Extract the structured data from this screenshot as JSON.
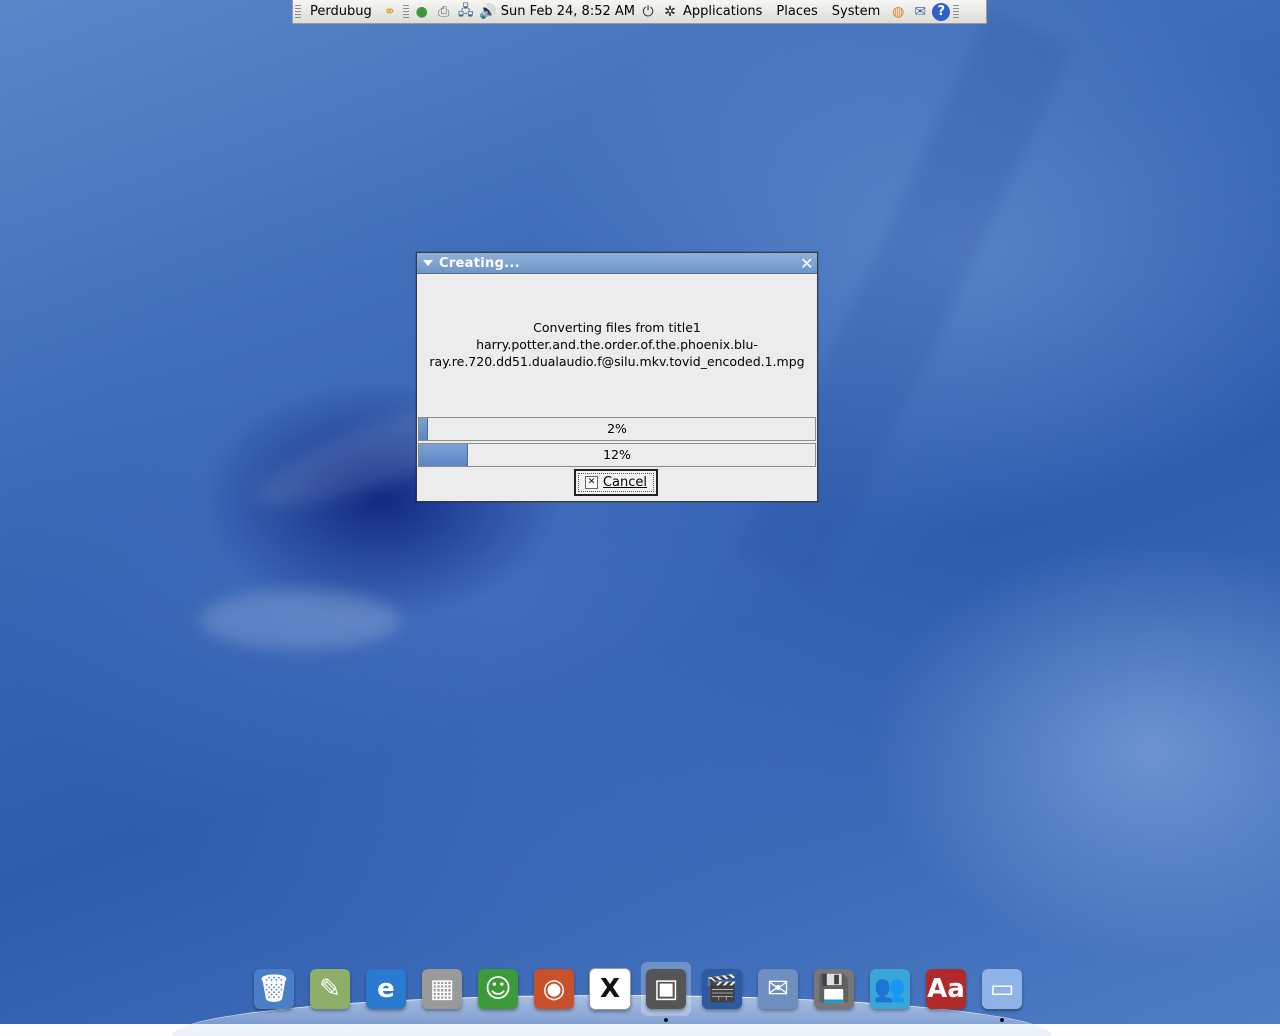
{
  "panel": {
    "user": "Perdubug",
    "clock": "Sun Feb 24,  8:52 AM",
    "menus": [
      "Applications",
      "Places",
      "System"
    ]
  },
  "dialog": {
    "title": "Creating...",
    "message_line1": "Converting files from title1",
    "message_line2": "harry.potter.and.the.order.of.the.phoenix.blu-",
    "message_line3": "ray.re.720.dd51.dualaudio.f@silu.mkv.tovid_encoded.1.mpg",
    "progress1": {
      "label": "2%",
      "fraction": 0.02
    },
    "progress2": {
      "label": "12%",
      "fraction": 0.12
    },
    "cancel_label": "Cancel"
  },
  "dock": {
    "items": [
      {
        "icon": "trash-icon",
        "color": "#4a7fc8",
        "glyph": "🗑"
      },
      {
        "icon": "text-editor-icon",
        "color": "#8fae6a",
        "glyph": "✎"
      },
      {
        "icon": "web-browser-icon",
        "color": "#2a7ad0",
        "glyph": "e"
      },
      {
        "icon": "calculator-icon",
        "color": "#9a9a9a",
        "glyph": "▦"
      },
      {
        "icon": "instant-messenger-icon",
        "color": "#3d9a3a",
        "glyph": "☺"
      },
      {
        "icon": "disc-burner-icon",
        "color": "#c8502a",
        "glyph": "◉"
      },
      {
        "icon": "x11-icon",
        "color": "#ffffff",
        "glyph": "X"
      },
      {
        "icon": "screen-capture-icon",
        "color": "#555555",
        "glyph": "▣"
      },
      {
        "icon": "video-editor-icon",
        "color": "#2d5aa0",
        "glyph": "🎬"
      },
      {
        "icon": "mail-icon",
        "color": "#6e8fc0",
        "glyph": "✉"
      },
      {
        "icon": "disk-backup-icon",
        "color": "#777777",
        "glyph": "💾"
      },
      {
        "icon": "messenger-people-icon",
        "color": "#3aa6d8",
        "glyph": "👥"
      },
      {
        "icon": "dictionary-icon",
        "color": "#b02a2a",
        "glyph": "Aa"
      },
      {
        "icon": "folder-icon",
        "color": "#8fb3e6",
        "glyph": "▭"
      }
    ]
  }
}
